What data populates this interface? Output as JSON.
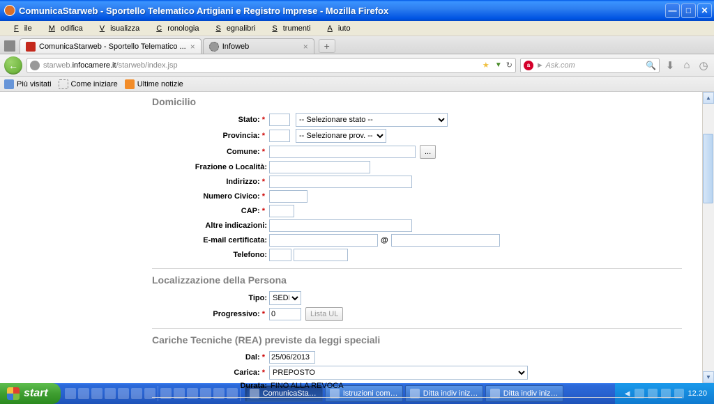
{
  "window": {
    "title": "ComunicaStarweb - Sportello Telematico Artigiani e Registro Imprese - Mozilla Firefox"
  },
  "menu": {
    "file": "File",
    "file_u": "F",
    "edit": "Modifica",
    "edit_u": "M",
    "view": "Visualizza",
    "view_u": "V",
    "history": "Cronologia",
    "history_u": "C",
    "bookmarks": "Segnalibri",
    "bookmarks_u": "S",
    "tools": "Strumenti",
    "tools_u": "S",
    "help": "Aiuto",
    "help_u": "A"
  },
  "tabs": {
    "tab1": "ComunicaStarweb - Sportello Telematico ...",
    "tab2": "Infoweb"
  },
  "url": {
    "prefix": "starweb.",
    "domain": "infocamere.it",
    "suffix": "/starweb/index.jsp"
  },
  "search": {
    "placeholder": "► Ask.com"
  },
  "bookmarks": {
    "mostvisited": "Più visitati",
    "comeiniziare": "Come iniziare",
    "ultimenotizie": "Ultime notizie"
  },
  "form": {
    "section1": "Domicilio",
    "stato_label": "Stato:",
    "stato_placeholder": "-- Selezionare stato --",
    "provincia_label": "Provincia:",
    "provincia_placeholder": "-- Selezionare prov. --",
    "comune_label": "Comune:",
    "comune_btn": "...",
    "frazione_label": "Frazione o Località:",
    "indirizzo_label": "Indirizzo:",
    "civico_label": "Numero Civico:",
    "cap_label": "CAP:",
    "altre_label": "Altre indicazioni:",
    "email_label": "E-mail certificata:",
    "at": "@",
    "telefono_label": "Telefono:",
    "section2": "Localizzazione della Persona",
    "tipo_label": "Tipo:",
    "tipo_value": "SEDE",
    "progressivo_label": "Progressivo:",
    "progressivo_value": "0",
    "listaul_btn": "Lista UL",
    "section3": "Cariche Tecniche (REA) previste da leggi speciali",
    "dal_label": "Dal:",
    "dal_value": "25/06/2013",
    "carica_label": "Carica:",
    "carica_value": "PREPOSTO",
    "durata_label": "Durata:",
    "durata_value": "FINO ALLA REVOCA"
  },
  "taskbar": {
    "start": "start",
    "task1": "ComunicaStarweb - S...",
    "task2": "Istruzioni compilazion...",
    "task3": "Ditta indiv inizio press...",
    "task4": "Ditta indiv inizo press...",
    "time": "12.20"
  }
}
